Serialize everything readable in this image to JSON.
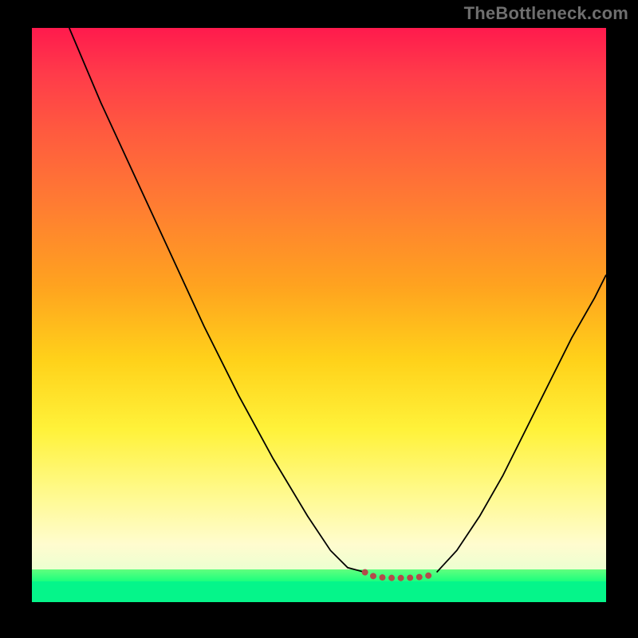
{
  "attribution": "TheBottleneck.com",
  "chart_data": {
    "type": "line",
    "title": "",
    "xlabel": "",
    "ylabel": "",
    "xlim": [
      0,
      100
    ],
    "ylim": [
      0,
      100
    ],
    "series": [
      {
        "name": "left-branch",
        "x": [
          6.5,
          12,
          18,
          24,
          30,
          36,
          42,
          48,
          52,
          55,
          58
        ],
        "values": [
          100,
          87,
          74,
          61,
          48,
          36,
          25,
          15,
          9,
          6,
          5.2
        ]
      },
      {
        "name": "valley-marker",
        "x": [
          58,
          59,
          61,
          63,
          65,
          67,
          69,
          70.5
        ],
        "values": [
          5.2,
          4.6,
          4.3,
          4.2,
          4.2,
          4.3,
          4.6,
          5.2
        ],
        "style": "dotted-thick",
        "color": "#b44a4a"
      },
      {
        "name": "right-branch",
        "x": [
          70.5,
          74,
          78,
          82,
          86,
          90,
          94,
          98,
          100
        ],
        "values": [
          5.2,
          9,
          15,
          22,
          30,
          38,
          46,
          53,
          57
        ]
      }
    ],
    "background_gradient": {
      "top": "#ff1a4d",
      "mid1": "#ff7a33",
      "mid2": "#ffd21a",
      "mid3": "#fffccf",
      "bottom": "#05f58a"
    }
  }
}
